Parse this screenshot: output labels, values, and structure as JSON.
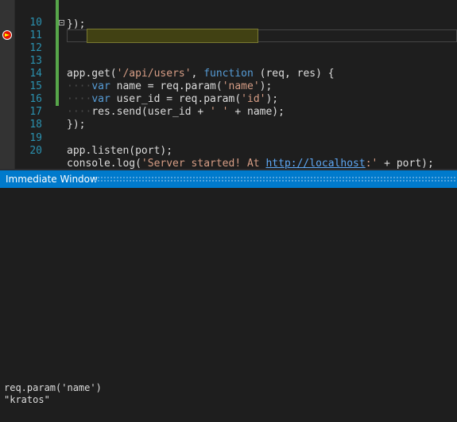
{
  "editor": {
    "partial_top_line": "});",
    "lines": [
      {
        "num": "10",
        "text": ""
      },
      {
        "num": "11",
        "text": "app.get('/api/users', function (req, res) {"
      },
      {
        "num": "12",
        "text": "    var user_id = req.param('id');"
      },
      {
        "num": "13",
        "text": "    var name = req.param('name');"
      },
      {
        "num": "14",
        "text": ""
      },
      {
        "num": "15",
        "text": "    res.send(user_id + ' ' + name);"
      },
      {
        "num": "16",
        "text": "});"
      },
      {
        "num": "17",
        "text": ""
      },
      {
        "num": "18",
        "text": ""
      },
      {
        "num": "19",
        "text": "app.listen(port);"
      },
      {
        "num": "20",
        "text": "console.log('Server started! At http://localhost:' + port);"
      }
    ],
    "tokens": {
      "l11_a": "app.get(",
      "l11_str": "'/api/users'",
      "l11_b": ", ",
      "l11_kw": "function",
      "l11_c": " (req, res) {",
      "l12_kw": "var",
      "l12_a": " user_id = req.param(",
      "l12_str": "'id'",
      "l12_b": ");",
      "l13_kw": "var",
      "l13_a": " name = req.param(",
      "l13_str": "'name'",
      "l13_b": ");",
      "l15_a": "res.send(user_id + ",
      "l15_str": "' '",
      "l15_b": " + name);",
      "l16": "});",
      "l19": "app.listen(port);",
      "l20_a": "console.log(",
      "l20_str1": "'Server started! At ",
      "l20_url": "http://localhost",
      "l20_str2": ":'",
      "l20_b": " + port);"
    },
    "current_line": "12",
    "breakpoint_icon": "breakpoint-current-statement-icon",
    "colors": {
      "keyword": "#569cd6",
      "string": "#d69d85",
      "line_number": "#2b91af",
      "current_statement_bg": "#414113",
      "breakpoint": "#e51400",
      "change_bar": "#57a64a"
    }
  },
  "immediate_window": {
    "title": "Immediate Window",
    "title_bar_color": "#007acc",
    "output": [
      "req.param('name')",
      "\"kratos\""
    ]
  }
}
